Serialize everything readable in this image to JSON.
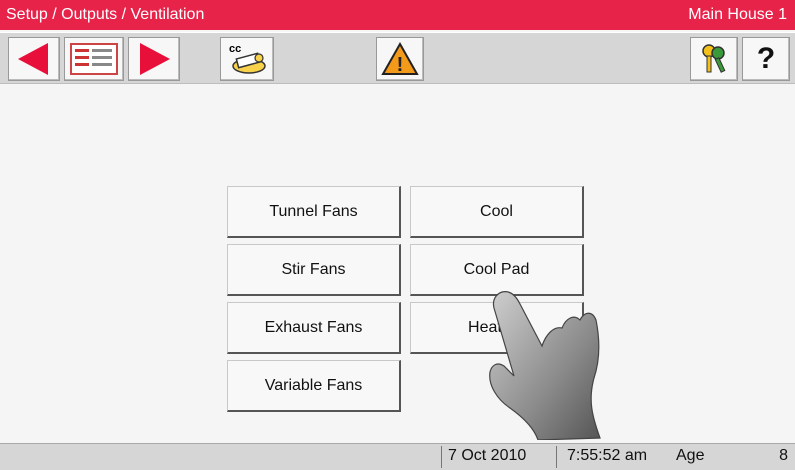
{
  "header": {
    "breadcrumb": "Setup / Outputs / Ventilation",
    "house": "Main House 1"
  },
  "toolbar": {
    "prev_icon": "arrow-left-icon",
    "menu_icon": "list-icon",
    "next_icon": "arrow-right-icon",
    "climate_icon": "cc-chick-icon",
    "climate_label": "cc",
    "alarm_icon": "warning-icon",
    "alarm_glyph": "!",
    "keys_icon": "keys-icon",
    "help_glyph": "?"
  },
  "menu": {
    "tunnel_fans": "Tunnel Fans",
    "cool": "Cool",
    "stir_fans": "Stir Fans",
    "cool_pad": "Cool Pad",
    "exhaust_fans": "Exhaust Fans",
    "heat_zone": "Heat Zo",
    "variable_fans": "Variable Fans"
  },
  "status": {
    "date": "7 Oct 2010",
    "time": "7:55:52 am",
    "age_label": "Age",
    "age_value": "8"
  },
  "colors": {
    "title_bar": "#e8234a",
    "arrow_red": "#e8103a",
    "warning_orange": "#f39a1b"
  }
}
